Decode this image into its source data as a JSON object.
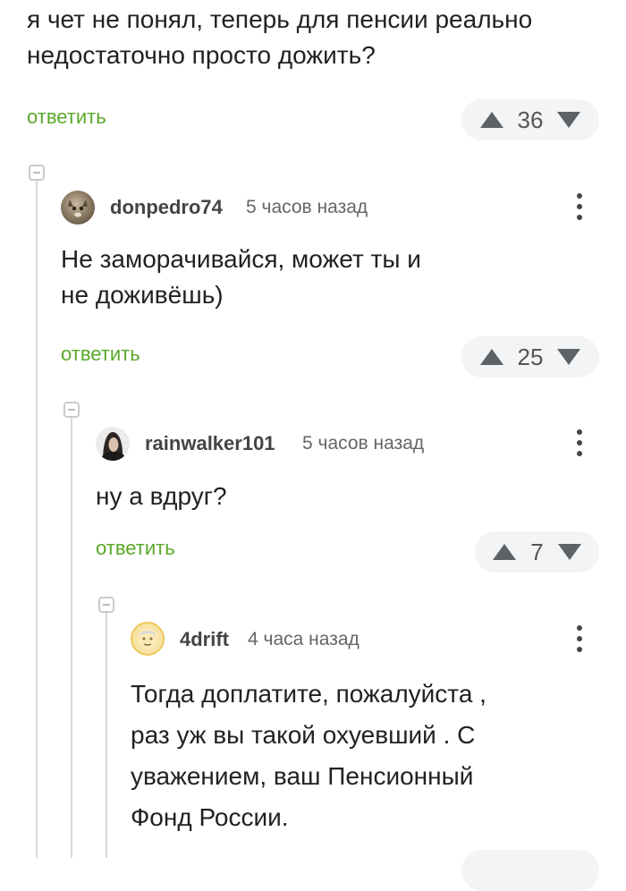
{
  "top_comment": {
    "text": "я чет не понял, теперь для пенсии реально\nнедостаточно просто дожить?",
    "reply_label": "ответить",
    "votes": "36"
  },
  "comments": [
    {
      "username": "donpedro74",
      "time": "5 часов назад",
      "text": "Не заморачивайся, может ты и\nне доживёшь)",
      "reply_label": "ответить",
      "votes": "25"
    },
    {
      "username": "rainwalker101",
      "time": "5 часов назад",
      "text": "ну а вдруг?",
      "reply_label": "ответить",
      "votes": "7"
    },
    {
      "username": "4drift",
      "time": "4 часа назад",
      "text": "Тогда доплатите, пожалуйста ,\nраз уж вы такой охуевший . С\nуважением, ваш Пенсионный\nФонд России."
    }
  ],
  "colors": {
    "reply_link": "#5aa82a",
    "vote_bg": "#f2f4f5",
    "thread_line": "#d6d9db"
  }
}
